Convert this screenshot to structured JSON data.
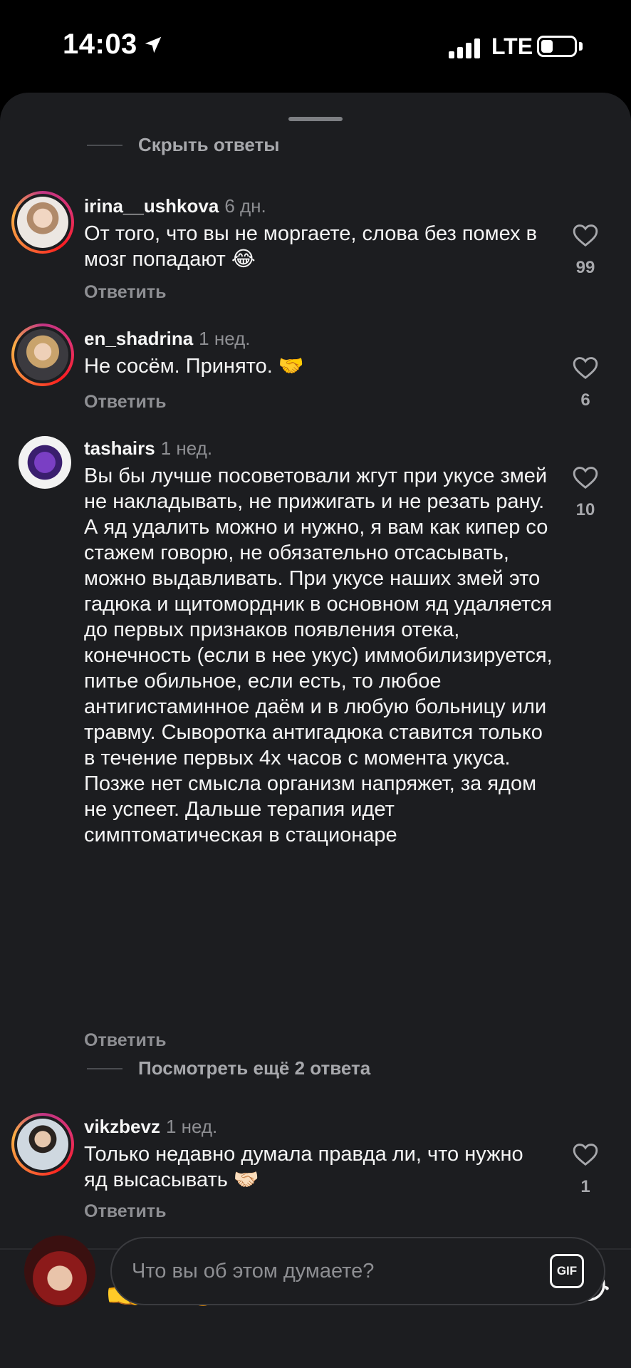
{
  "status": {
    "time": "14:03",
    "network": "LTE"
  },
  "thread": {
    "hide_label": "Скрыть ответы",
    "more_label": "Посмотреть ещё 2 ответа"
  },
  "comments": [
    {
      "username": "irina__ushkova",
      "time": "6 дн.",
      "text": "От того, что вы не моргаете, слова без помех в мозг попадают 😂",
      "reply": "Ответить",
      "likes": "99"
    },
    {
      "username": "en_shadrina",
      "time": "1 нед.",
      "text": "Не сосём. Принято. 🤝",
      "reply": "Ответить",
      "likes": "6"
    },
    {
      "username": "tashairs",
      "time": "1 нед.",
      "text": "Вы бы лучше посоветовали жгут при укусе змей не накладывать, не прижигать и не резать рану. А яд удалить можно и нужно, я вам как кипер со стажем говорю, не обязательно отсасывать, можно выдавливать. При укусе наших змей это гадюка и щитомордник в основном яд удаляется до первых признаков появления отека, конечность (если в нее укус) иммобилизируется, питье обильное, если есть, то любое антигистаминное даём и в любую больницу или травму. Сыворотка антигадюка ставится только в течение первых 4х часов с момента укуса. Позже нет смысла организм напряжет,  за ядом не успеет. Дальше терапия идет симптоматическая в стационаре",
      "reply": "Ответить",
      "likes": "10"
    },
    {
      "username": "vikzbevz",
      "time": "1 нед.",
      "text": "Только недавно думала правда ли, что нужно яд высасывать 🤝🏻",
      "reply": "Ответить",
      "likes": "1"
    }
  ],
  "quick_reactions": [
    "❤️",
    "👍",
    "🔥",
    "👏",
    "😅",
    "😍",
    "😁",
    "😂"
  ],
  "composer": {
    "placeholder": "Что вы об этом думаете?",
    "gif_label": "GIF"
  },
  "colors": {
    "sheet_bg": "#1c1d20",
    "story_ring": "#e1306c",
    "muted_text": "#8e8f93"
  }
}
